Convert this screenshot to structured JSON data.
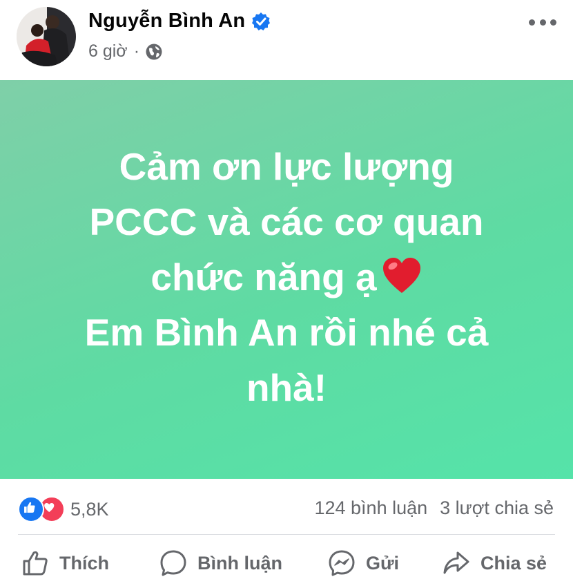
{
  "post": {
    "author": "Nguyễn Bình An",
    "time": "6 giờ",
    "separator": "·",
    "privacy_icon": "globe-icon",
    "verified_icon": "verified-badge-icon",
    "more_icon": "more-options-icon",
    "text_lines": [
      "Cảm ơn lực lượng",
      "PCCC và các cơ quan",
      "chức năng ạ",
      "Em Bình An rồi nhé cả",
      "nhà!"
    ],
    "emoji": "heart-emoji",
    "background_gradient": [
      "#7fcfa8",
      "#55e3a9"
    ]
  },
  "stats": {
    "reaction_icons": [
      "like-reaction-icon",
      "love-reaction-icon"
    ],
    "reaction_count": "5,8K",
    "comments": "124 bình luận",
    "shares": "3 lượt chia sẻ"
  },
  "actions": {
    "like": "Thích",
    "comment": "Bình luận",
    "send": "Gửi",
    "share": "Chia sẻ"
  },
  "colors": {
    "brand_blue": "#1877f2",
    "love_red": "#f33e58",
    "secondary_text": "#65676b"
  }
}
